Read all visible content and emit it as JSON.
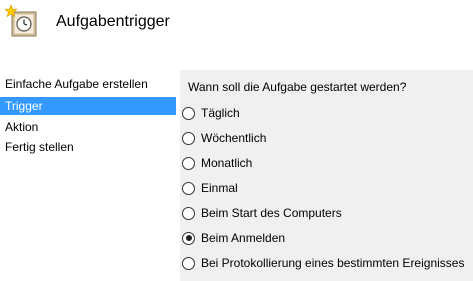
{
  "header": {
    "title": "Aufgabentrigger",
    "icon": "task-scheduler-clock-icon"
  },
  "steps": [
    {
      "label": "Einfache Aufgabe erstellen",
      "active": false
    },
    {
      "label": "Trigger",
      "active": true
    },
    {
      "label": "Aktion",
      "active": false
    },
    {
      "label": "Fertig stellen",
      "active": false
    }
  ],
  "question": "Wann soll die Aufgabe gestartet werden?",
  "options": [
    {
      "label": "Täglich",
      "checked": false
    },
    {
      "label": "Wöchentlich",
      "checked": false
    },
    {
      "label": "Monatlich",
      "checked": false
    },
    {
      "label": "Einmal",
      "checked": false
    },
    {
      "label": "Beim Start des Computers",
      "checked": false
    },
    {
      "label": "Beim Anmelden",
      "checked": true
    },
    {
      "label": "Bei Protokollierung eines bestimmten Ereignisses",
      "checked": false
    }
  ],
  "colors": {
    "accent": "#3399ff",
    "panel": "#f0f0f0"
  }
}
